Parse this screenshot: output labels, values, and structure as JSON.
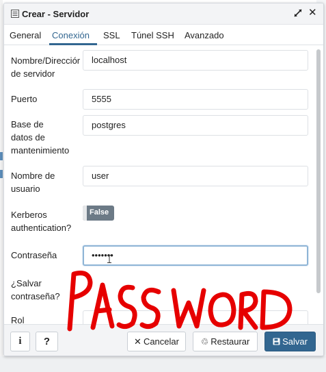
{
  "dialog": {
    "title": "Crear - Servidor"
  },
  "tabs": [
    {
      "label": "General"
    },
    {
      "label": "Conexión"
    },
    {
      "label": "SSL"
    },
    {
      "label": "Túnel SSH"
    },
    {
      "label": "Avanzado"
    }
  ],
  "active_tab": "Conexión",
  "form": {
    "host_label_1": "Nombre/Direcciór",
    "host_label_2": "de servidor",
    "host_value": "localhost",
    "port_label": "Puerto",
    "port_value": "5555",
    "db_label_1": "Base de",
    "db_label_2": "datos de",
    "db_label_3": "mantenimiento",
    "db_value": "postgres",
    "user_label_1": "Nombre de",
    "user_label_2": "usuario",
    "user_value": "user",
    "kerberos_label_1": "Kerberos",
    "kerberos_label_2": "authentication?",
    "kerberos_value": "False",
    "password_label": "Contraseña",
    "password_value": "•••••••",
    "save_password_label_1": "¿Salvar",
    "save_password_label_2": "contraseña?",
    "role_label": "Rol",
    "role_value": ""
  },
  "annotation_text": "PASSWORD",
  "footer": {
    "info_label": "i",
    "help_label": "?",
    "cancel_label": "Cancelar",
    "reset_label": "Restaurar",
    "save_label": "Salvar"
  },
  "colors": {
    "accent": "#326690",
    "scribble": "#e60000",
    "toggle_off": "#6c7a86"
  }
}
